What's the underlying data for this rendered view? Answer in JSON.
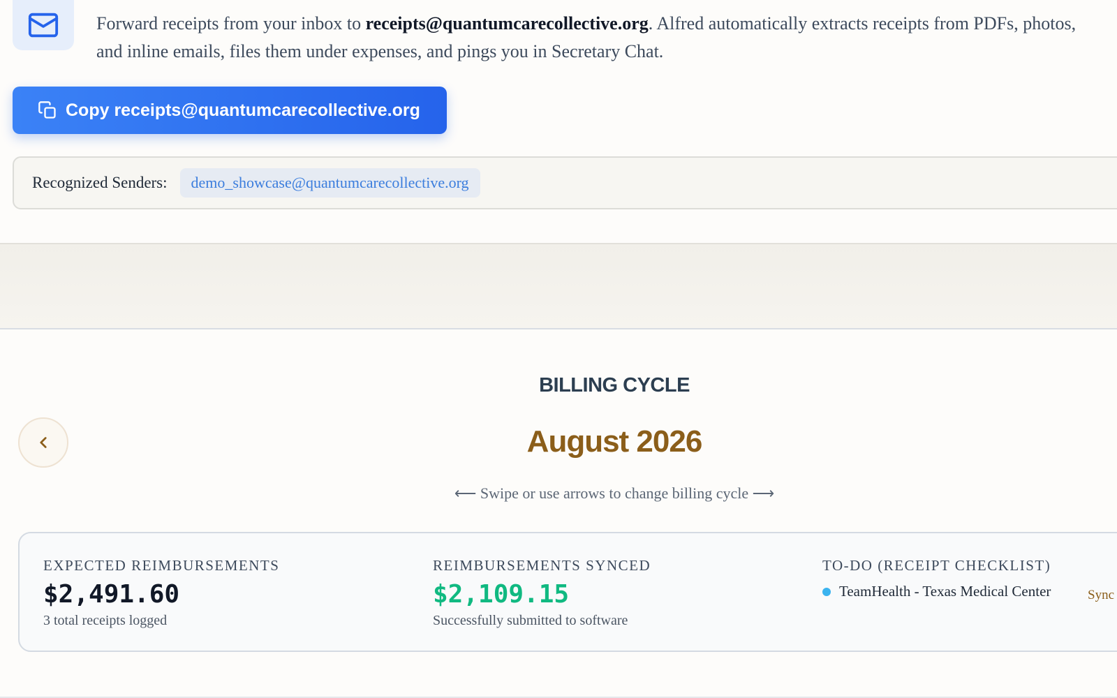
{
  "intro": {
    "text_before": "Forward receipts from your inbox to ",
    "email": "receipts@quantumcarecollective.org",
    "text_after": ". Alfred automatically extracts receipts from PDFs, photos, and inline emails, files them under expenses, and pings you in Secretary Chat."
  },
  "copy_button": {
    "label": "Copy receipts@quantumcarecollective.org",
    "icon": "copy-icon"
  },
  "senders": {
    "label": "Recognized Senders:",
    "items": [
      "demo_showcase@quantumcarecollective.org"
    ]
  },
  "billing": {
    "label": "BILLING CYCLE",
    "month": "August 2026",
    "hint": "⟵ Swipe or use arrows to change billing cycle ⟶"
  },
  "stats": {
    "expected": {
      "title": "EXPECTED REIMBURSEMENTS",
      "value": "$2,491.60",
      "sub": "3 total receipts logged"
    },
    "synced": {
      "title": "REIMBURSEMENTS SYNCED",
      "value": "$2,109.15",
      "sub": "Successfully submitted to software"
    },
    "todo": {
      "title": "TO-DO (RECEIPT CHECKLIST)",
      "items": [
        {
          "label": "TeamHealth - Texas Medical Center",
          "action": "Sync"
        }
      ]
    }
  },
  "colors": {
    "accent": "#2563eb",
    "month": "#8b5e1a",
    "synced": "#10b981",
    "todo_dot": "#3bb3ef"
  }
}
